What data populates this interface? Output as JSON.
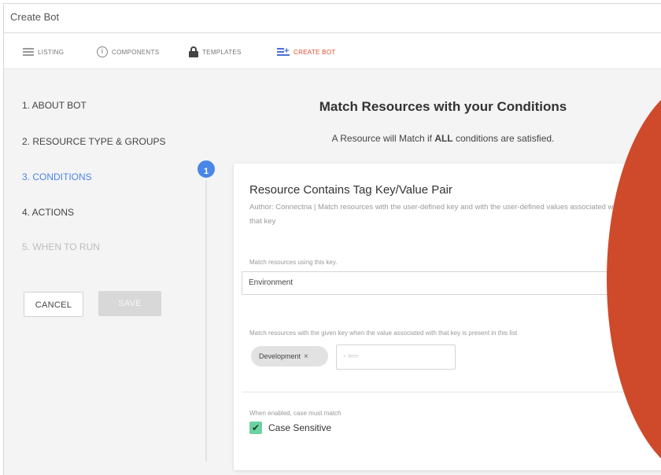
{
  "window": {
    "title": "Create Bot"
  },
  "toolbar": {
    "items": [
      {
        "label": "LISTING",
        "icon": "list-icon"
      },
      {
        "label": "COMPONENTS",
        "icon": "info-circle-icon"
      },
      {
        "label": "TEMPLATES",
        "icon": "lock-icon"
      },
      {
        "label": "CREATE BOT",
        "icon": "add-list-icon",
        "active": true
      }
    ]
  },
  "steps": [
    {
      "label": "1. ABOUT BOT",
      "state": "done"
    },
    {
      "label": "2. RESOURCE TYPE & GROUPS",
      "state": "done"
    },
    {
      "label": "3. CONDITIONS",
      "state": "current"
    },
    {
      "label": "4. ACTIONS",
      "state": "done"
    },
    {
      "label": "5. WHEN TO RUN",
      "state": "disabled"
    }
  ],
  "buttons": {
    "cancel": "CANCEL",
    "save": "SAVE"
  },
  "main": {
    "heading": "Match Resources with your Conditions",
    "subheading_pre": "A Resource will Match if ",
    "subheading_bold": "ALL",
    "subheading_post": " conditions are satisfied."
  },
  "condition": {
    "number": "1",
    "title": "Resource Contains Tag Key/Value Pair",
    "description": "Author: Connectria | Match resources with the user-defined key and with the user-defined values associated with that key",
    "key_label": "Match resources using this key.",
    "key_value": "Environment",
    "values_label": "Match resources with the given key when the value associated with that key is present in this list",
    "chips": [
      {
        "label": "Development",
        "remove": "×"
      }
    ],
    "add_placeholder": "+ Item",
    "case_hint": "When enabled, case must match",
    "case_label": "Case Sensitive",
    "case_checked": "✔"
  },
  "colors": {
    "accent": "#4a86e8",
    "active_tab": "#e14a2b",
    "checkbox": "#6bd2a1",
    "decor": "#cf4a2a"
  }
}
